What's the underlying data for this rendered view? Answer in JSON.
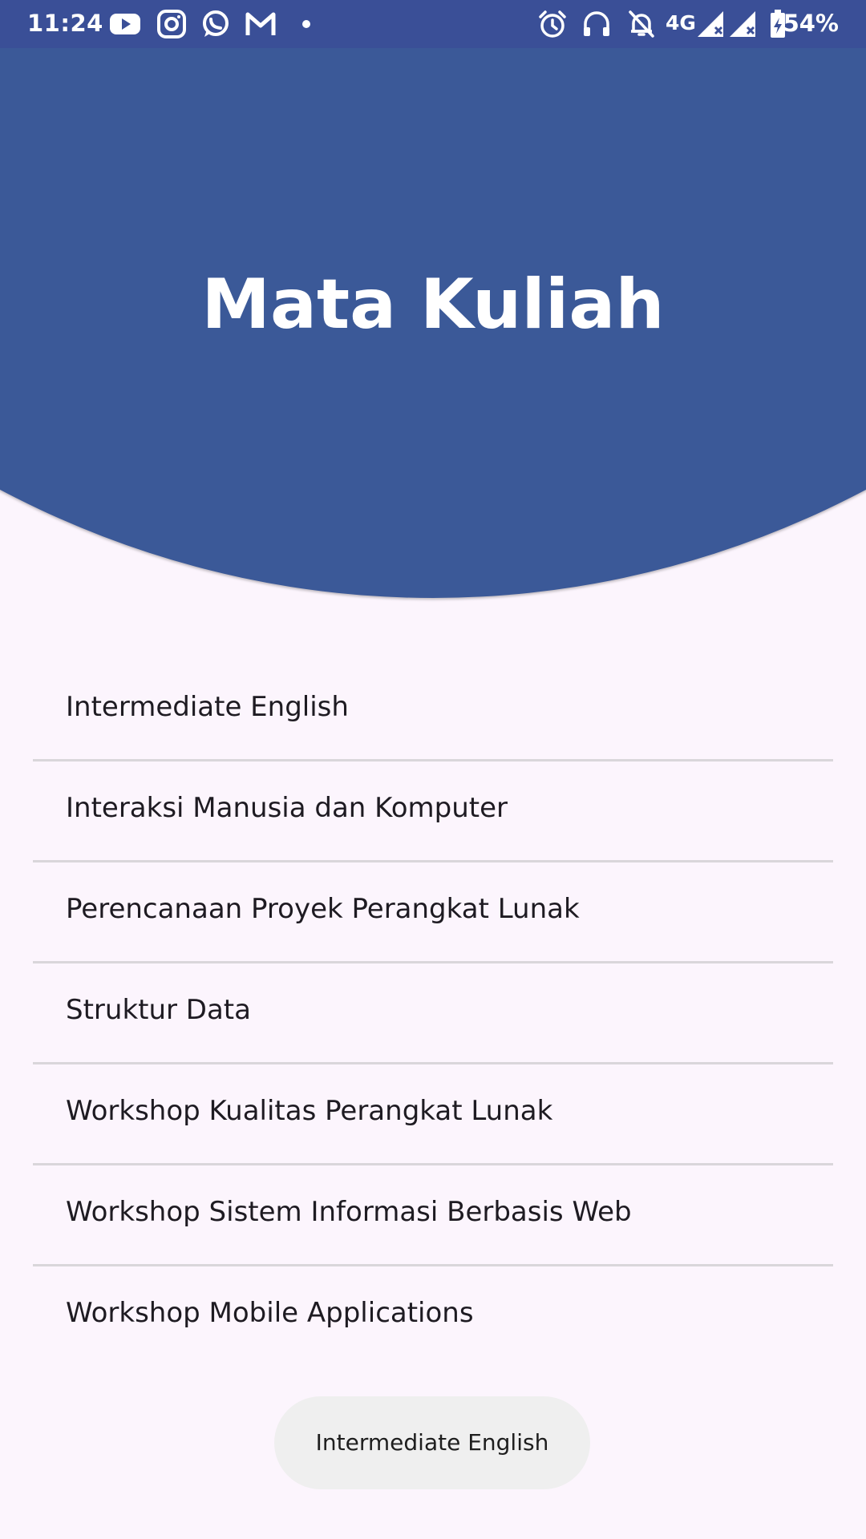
{
  "status_bar": {
    "time": "11:24",
    "network": "4G",
    "battery": "54%",
    "icons": [
      "youtube-icon",
      "instagram-icon",
      "whatsapp-icon",
      "gmail-icon",
      "dot-icon",
      "alarm-icon",
      "headphones-icon",
      "notifications-off-icon",
      "signal-icon",
      "signal-icon",
      "battery-icon"
    ]
  },
  "header": {
    "title": "Mata Kuliah",
    "color": "#3b5998"
  },
  "courses": [
    "Intermediate English",
    "Interaksi Manusia dan Komputer",
    "Perencanaan Proyek Perangkat Lunak",
    "Struktur Data",
    "Workshop Kualitas Perangkat Lunak",
    "Workshop Sistem Informasi Berbasis Web",
    "Workshop Mobile Applications"
  ],
  "toast": {
    "text": "Intermediate English"
  }
}
